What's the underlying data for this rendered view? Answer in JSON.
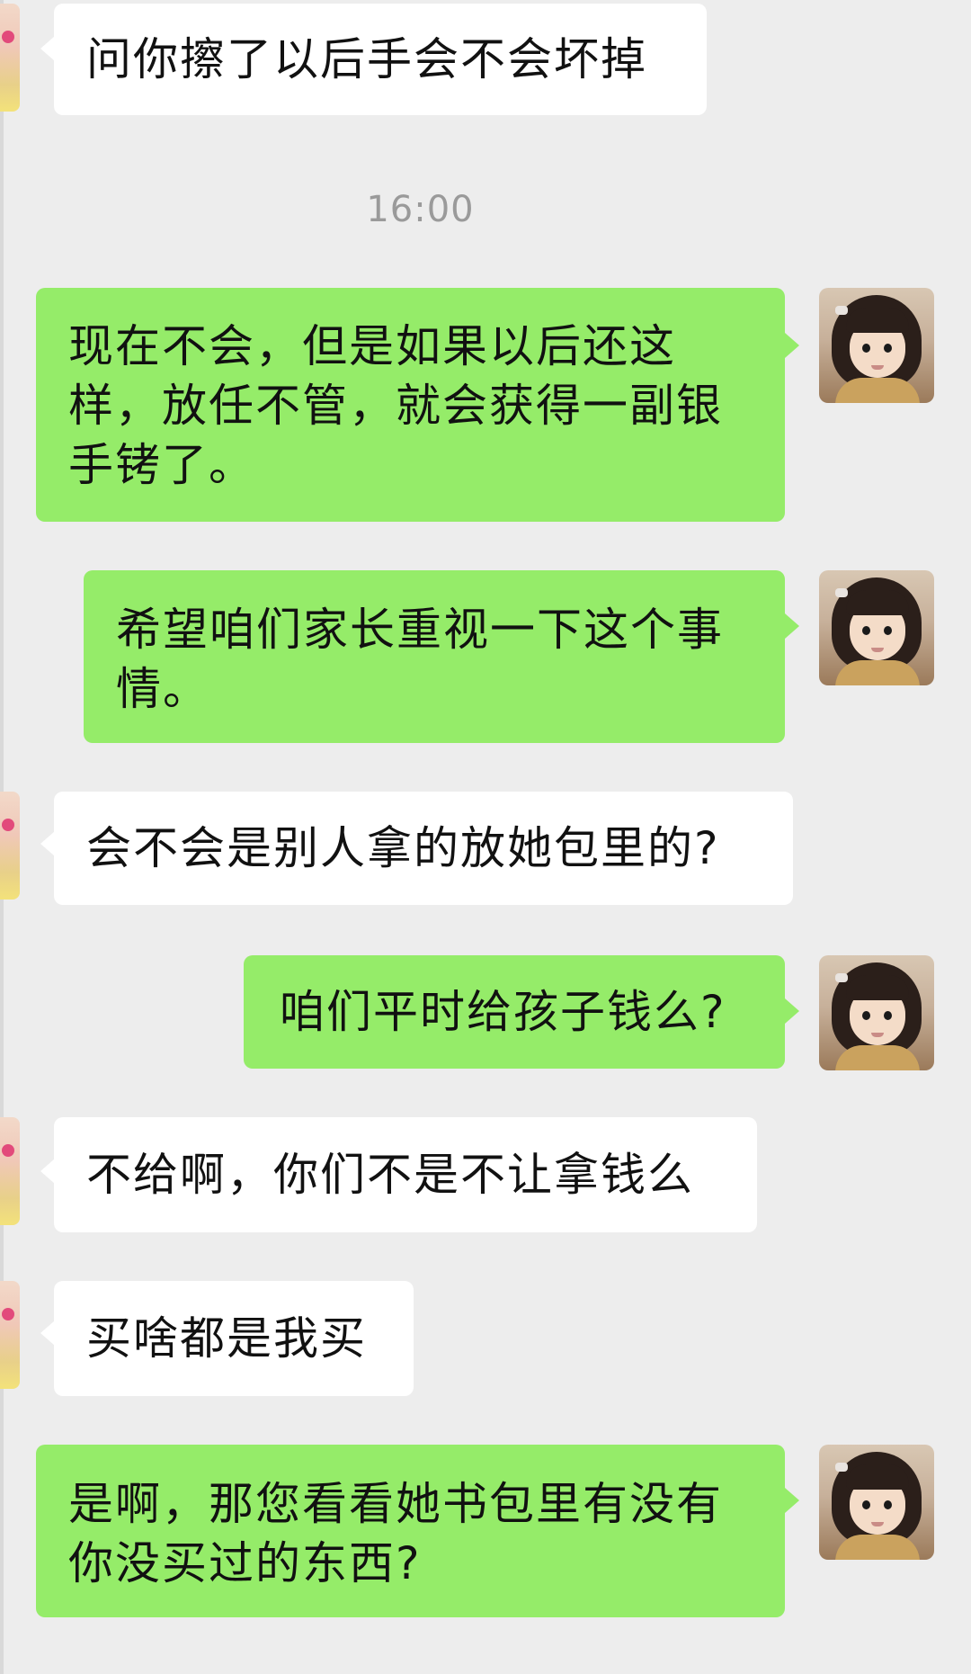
{
  "chat": {
    "timestamp": "16:00",
    "messages": [
      {
        "sender": "other",
        "text": "问你擦了以后手会不会坏掉"
      },
      {
        "sender": "me",
        "text": "现在不会，但是如果以后还这样，放任不管，就会获得一副银手铐了。"
      },
      {
        "sender": "me",
        "text": "希望咱们家长重视一下这个事情。"
      },
      {
        "sender": "other",
        "text": "会不会是别人拿的放她包里的?"
      },
      {
        "sender": "me",
        "text": "咱们平时给孩子钱么?"
      },
      {
        "sender": "other",
        "text": "不给啊，你们不是不让拿钱么"
      },
      {
        "sender": "other",
        "text": "买啥都是我买"
      },
      {
        "sender": "me",
        "text": "是啊，那您看看她书包里有没有你没买过的东西?"
      }
    ]
  },
  "colors": {
    "background": "#ededed",
    "me_bubble": "#95ec69",
    "other_bubble": "#ffffff",
    "timestamp_text": "#9a9a9a"
  },
  "icons": {
    "me_avatar": "girl-photo-avatar",
    "other_avatar": "contact-photo-avatar"
  }
}
